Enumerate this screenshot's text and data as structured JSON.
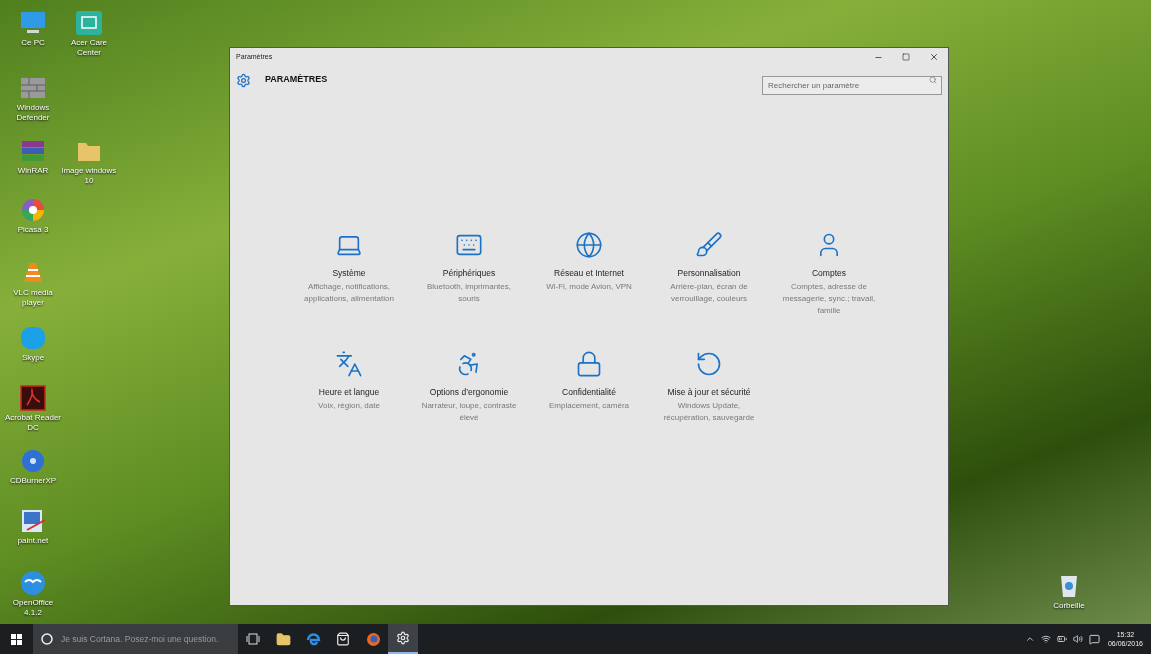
{
  "desktop": {
    "icons": [
      {
        "kind": "computer",
        "label": "Ce PC"
      },
      {
        "kind": "care",
        "label": "Acer Care Center"
      },
      {
        "kind": "wall",
        "label": "Windows Defender"
      },
      {
        "kind": "archive",
        "label": "WinRAR"
      },
      {
        "kind": "folder",
        "label": "image windows 10"
      },
      {
        "kind": "pinwheel",
        "label": "Picasa 3"
      },
      {
        "kind": "cone",
        "label": "VLC media player"
      },
      {
        "kind": "chat",
        "label": "Skype"
      },
      {
        "kind": "document",
        "label": "Acrobat Reader DC"
      },
      {
        "kind": "disc",
        "label": "CDBurnerXP"
      },
      {
        "kind": "picture",
        "label": "paint.net"
      },
      {
        "kind": "bird",
        "label": "OpenOffice 4.1.2"
      },
      {
        "kind": "trash",
        "label": "Corbeille"
      }
    ]
  },
  "window": {
    "title": "Paramètres",
    "header": "PARAMÈTRES",
    "search": {
      "placeholder": "Rechercher un paramètre"
    },
    "categories": [
      {
        "kind": "system",
        "title": "Système",
        "description": "Affichage, notifications, applications, alimentation"
      },
      {
        "kind": "devices",
        "title": "Périphériques",
        "description": "Bluetooth, imprimantes, souris"
      },
      {
        "kind": "network",
        "title": "Réseau et Internet",
        "description": "Wi-Fi, mode Avion, VPN"
      },
      {
        "kind": "personalization",
        "title": "Personnalisation",
        "description": "Arrière-plan, écran de verrouillage, couleurs"
      },
      {
        "kind": "accounts",
        "title": "Comptes",
        "description": "Comptes, adresse de messagerie, sync.; travail, famille"
      },
      {
        "kind": "time",
        "title": "Heure et langue",
        "description": "Voix, région, date"
      },
      {
        "kind": "ease",
        "title": "Options d’ergonomie",
        "description": "Narrateur, loupe, contraste élevé"
      },
      {
        "kind": "privacy",
        "title": "Confidentialité",
        "description": "Emplacement, caméra"
      },
      {
        "kind": "update",
        "title": "Mise à jour et sécurité",
        "description": "Windows Update, récupération, sauvegarde"
      }
    ]
  },
  "taskbar": {
    "search": {
      "placeholder": "Je suis Cortana. Posez-moi une question."
    },
    "apps": [
      {
        "kind": "taskview",
        "active": false
      },
      {
        "kind": "explorer",
        "active": false
      },
      {
        "kind": "edge",
        "active": false
      },
      {
        "kind": "store",
        "active": false
      },
      {
        "kind": "firefox",
        "active": false
      },
      {
        "kind": "settings",
        "active": true
      }
    ],
    "clock": {
      "time": "15:32",
      "date": "06/06/2016"
    }
  }
}
